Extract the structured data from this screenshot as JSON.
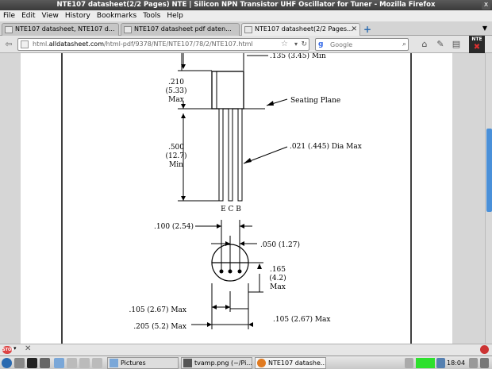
{
  "window": {
    "title": "NTE107 datasheet(2/2 Pages) NTE | Silicon NPN Transistor UHF Oscillator for Tuner - Mozilla Firefox",
    "close_glyph": "x"
  },
  "menu": [
    "File",
    "Edit",
    "View",
    "History",
    "Bookmarks",
    "Tools",
    "Help"
  ],
  "tabs": [
    {
      "label": "NTE107 datasheet, NTE107 d..."
    },
    {
      "label": "NTE107 datasheet pdf daten..."
    },
    {
      "label": "NTE107 datasheet(2/2 Pages..."
    }
  ],
  "nav": {
    "url_prefix": "html.",
    "url_domain": "alldatasheet.com",
    "url_path": "/html-pdf/9378/NTE/NTE107/78/2/NTE107.html",
    "search_placeholder": "Google",
    "search_engine_glyph": "g"
  },
  "extension_icon": {
    "label": "NTE"
  },
  "drawing": {
    "dim_top": ".135 (3.45) Min",
    "dim_body_in": ".210",
    "dim_body_mm": "(5.33)",
    "dim_body_q": "Max",
    "seating_plane": "Seating Plane",
    "lead_dia": ".021 (.445) Dia Max",
    "dim_lead_in": ".500",
    "dim_lead_mm": "(12.7)",
    "dim_lead_q": "Min",
    "pin_labels": "E C B",
    "pitch": ".100 (2.54)",
    "half_pitch": ".050 (1.27)",
    "flat_in": ".165",
    "flat_mm": "(4.2)",
    "flat_q": "Max",
    "width_left": ".105 (2.67) Max",
    "width_right": ".105 (2.67) Max",
    "total_width": ".205 (5.2) Max"
  },
  "taskbar": {
    "tasks": [
      {
        "label": "Pictures"
      },
      {
        "label": "tvamp.png (~/Pi..."
      },
      {
        "label": "NTE107 datashe..."
      }
    ],
    "clock": "18:04"
  },
  "statusbar": {
    "badge": "STOP"
  },
  "colors": {
    "accent_blue": "#4a90d9",
    "status_green": "#2ee02e"
  }
}
